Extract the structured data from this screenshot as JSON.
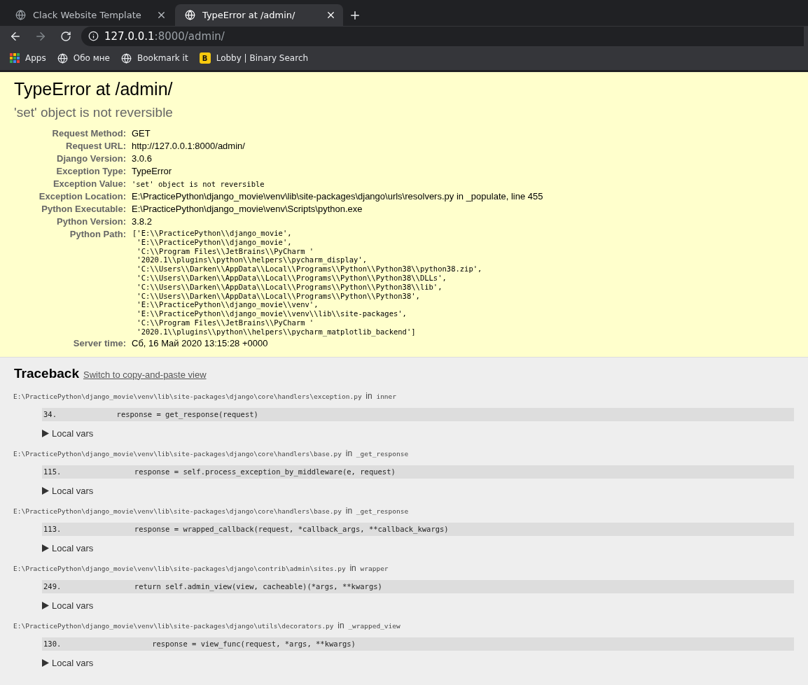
{
  "browser": {
    "tabs": [
      {
        "title": "Clack Website Template",
        "selected": false
      },
      {
        "title": "TypeError at /admin/",
        "selected": true
      }
    ],
    "nav": [
      {
        "kind": "back",
        "disabled": false
      },
      {
        "kind": "forward",
        "disabled": true
      },
      {
        "kind": "reload",
        "disabled": false
      }
    ],
    "address": {
      "host": "127.0.0.1",
      "path": ":8000/admin/"
    },
    "bookmarks": [
      {
        "kind": "apps",
        "label": "Apps"
      },
      {
        "kind": "globe",
        "label": "Обо мне"
      },
      {
        "kind": "globe",
        "label": "Bookmark it"
      },
      {
        "kind": "letter",
        "letter": "B",
        "label": "Lobby | Binary Search"
      }
    ]
  },
  "summary": {
    "title": "TypeError at /admin/",
    "message": "'set' object is not reversible",
    "meta": [
      {
        "label": "Request Method:",
        "kind": "text",
        "value": "GET"
      },
      {
        "label": "Request URL:",
        "kind": "text",
        "value": "http://127.0.0.1:8000/admin/"
      },
      {
        "label": "Django Version:",
        "kind": "text",
        "value": "3.0.6"
      },
      {
        "label": "Exception Type:",
        "kind": "text",
        "value": "TypeError"
      },
      {
        "label": "Exception Value:",
        "kind": "mono",
        "value": "'set' object is not reversible"
      },
      {
        "label": "Exception Location:",
        "kind": "text",
        "value": "E:\\PracticePython\\django_movie\\venv\\lib\\site-packages\\django\\urls\\resolvers.py in _populate, line 455"
      },
      {
        "label": "Python Executable:",
        "kind": "text",
        "value": "E:\\PracticePython\\django_movie\\venv\\Scripts\\python.exe"
      },
      {
        "label": "Python Version:",
        "kind": "text",
        "value": "3.8.2"
      },
      {
        "label": "Python Path:",
        "kind": "lines",
        "lines": [
          "['E:\\\\PracticePython\\\\django_movie',",
          " 'E:\\\\PracticePython\\\\django_movie',",
          " 'C:\\\\Program Files\\\\JetBrains\\\\PyCharm '",
          " '2020.1\\\\plugins\\\\python\\\\helpers\\\\pycharm_display',",
          " 'C:\\\\Users\\\\Darken\\\\AppData\\\\Local\\\\Programs\\\\Python\\\\Python38\\\\python38.zip',",
          " 'C:\\\\Users\\\\Darken\\\\AppData\\\\Local\\\\Programs\\\\Python\\\\Python38\\\\DLLs',",
          " 'C:\\\\Users\\\\Darken\\\\AppData\\\\Local\\\\Programs\\\\Python\\\\Python38\\\\lib',",
          " 'C:\\\\Users\\\\Darken\\\\AppData\\\\Local\\\\Programs\\\\Python\\\\Python38',",
          " 'E:\\\\PracticePython\\\\django_movie\\\\venv',",
          " 'E:\\\\PracticePython\\\\django_movie\\\\venv\\\\lib\\\\site-packages',",
          " 'C:\\\\Program Files\\\\JetBrains\\\\PyCharm '",
          " '2020.1\\\\plugins\\\\python\\\\helpers\\\\pycharm_matplotlib_backend']"
        ]
      },
      {
        "label": "Server time:",
        "kind": "text",
        "value": "Сб, 16 Май 2020 13:15:28 +0000"
      }
    ]
  },
  "traceback": {
    "title": "Traceback",
    "switch_link": "Switch to copy-and-paste view",
    "frames": [
      {
        "file": "E:\\PracticePython\\django_movie\\venv\\lib\\site-packages\\django\\core\\handlers\\exception.py",
        "in_word": "in",
        "function": "inner",
        "line_number": "34.",
        "code": "        response = get_response(request)",
        "vars_label": "Local vars",
        "expanded": false
      },
      {
        "file": "E:\\PracticePython\\django_movie\\venv\\lib\\site-packages\\django\\core\\handlers\\base.py",
        "in_word": "in",
        "function": "_get_response",
        "line_number": "115.",
        "code": "            response = self.process_exception_by_middleware(e, request)",
        "vars_label": "Local vars",
        "expanded": false
      },
      {
        "file": "E:\\PracticePython\\django_movie\\venv\\lib\\site-packages\\django\\core\\handlers\\base.py",
        "in_word": "in",
        "function": "_get_response",
        "line_number": "113.",
        "code": "            response = wrapped_callback(request, *callback_args, **callback_kwargs)",
        "vars_label": "Local vars",
        "expanded": false
      },
      {
        "file": "E:\\PracticePython\\django_movie\\venv\\lib\\site-packages\\django\\contrib\\admin\\sites.py",
        "in_word": "in",
        "function": "wrapper",
        "line_number": "249.",
        "code": "            return self.admin_view(view, cacheable)(*args, **kwargs)",
        "vars_label": "Local vars",
        "expanded": false
      },
      {
        "file": "E:\\PracticePython\\django_movie\\venv\\lib\\site-packages\\django\\utils\\decorators.py",
        "in_word": "in",
        "function": "_wrapped_view",
        "line_number": "130.",
        "code": "                response = view_func(request, *args, **kwargs)",
        "vars_label": "Local vars",
        "expanded": false
      }
    ]
  }
}
